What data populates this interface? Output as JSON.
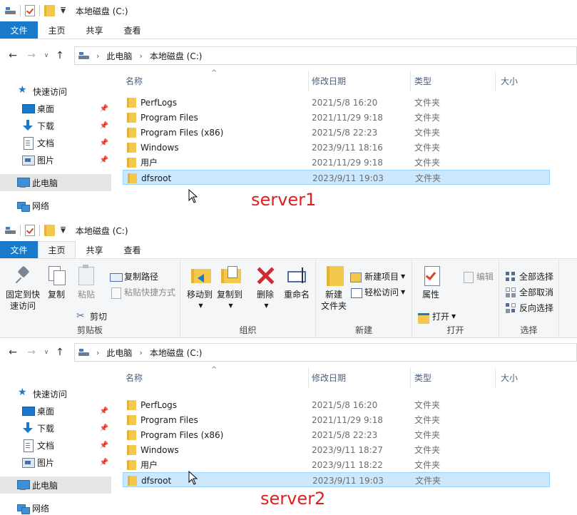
{
  "window1": {
    "title": "本地磁盘 (C:)",
    "tabs": [
      "文件",
      "主页",
      "共享",
      "查看"
    ],
    "breadcrumb": [
      "此电脑",
      "本地磁盘 (C:)"
    ],
    "sidebar": {
      "quick_access": "快速访问",
      "items": [
        "桌面",
        "下载",
        "文档",
        "图片"
      ],
      "this_pc": "此电脑",
      "network": "网络"
    },
    "columns": [
      "名称",
      "修改日期",
      "类型",
      "大小"
    ],
    "files": [
      {
        "name": "PerfLogs",
        "date": "2021/5/8 16:20",
        "type": "文件夹"
      },
      {
        "name": "Program Files",
        "date": "2021/11/29 9:18",
        "type": "文件夹"
      },
      {
        "name": "Program Files (x86)",
        "date": "2021/5/8 22:23",
        "type": "文件夹"
      },
      {
        "name": "Windows",
        "date": "2023/9/11 18:16",
        "type": "文件夹"
      },
      {
        "name": "用户",
        "date": "2021/11/29 9:18",
        "type": "文件夹"
      },
      {
        "name": "dfsroot",
        "date": "2023/9/11 19:03",
        "type": "文件夹"
      }
    ],
    "annotation": "server1"
  },
  "window2": {
    "title": "本地磁盘 (C:)",
    "tabs": [
      "文件",
      "主页",
      "共享",
      "查看"
    ],
    "ribbon": {
      "clipboard": {
        "pin": "固定到快速访问",
        "copy": "复制",
        "paste": "粘贴",
        "copy_path": "复制路径",
        "paste_shortcut": "粘贴快捷方式",
        "cut": "剪切",
        "label": "剪贴板"
      },
      "organize": {
        "move_to": "移动到",
        "copy_to": "复制到",
        "delete": "删除",
        "rename": "重命名",
        "label": "组织"
      },
      "new": {
        "new_folder": "新建\n文件夹",
        "new_item": "新建项目",
        "easy_access": "轻松访问",
        "label": "新建"
      },
      "open": {
        "properties": "属性",
        "open": "打开",
        "edit": "编辑",
        "label": "打开"
      },
      "select": {
        "select_all": "全部选择",
        "select_none": "全部取消",
        "invert": "反向选择",
        "label": "选择"
      }
    },
    "breadcrumb": [
      "此电脑",
      "本地磁盘 (C:)"
    ],
    "sidebar": {
      "quick_access": "快速访问",
      "items": [
        "桌面",
        "下载",
        "文档",
        "图片"
      ],
      "this_pc": "此电脑",
      "network": "网络"
    },
    "columns": [
      "名称",
      "修改日期",
      "类型",
      "大小"
    ],
    "files": [
      {
        "name": "PerfLogs",
        "date": "2021/5/8 16:20",
        "type": "文件夹"
      },
      {
        "name": "Program Files",
        "date": "2021/11/29 9:18",
        "type": "文件夹"
      },
      {
        "name": "Program Files (x86)",
        "date": "2021/5/8 22:23",
        "type": "文件夹"
      },
      {
        "name": "Windows",
        "date": "2023/9/11 18:27",
        "type": "文件夹"
      },
      {
        "name": "用户",
        "date": "2023/9/11 18:22",
        "type": "文件夹"
      },
      {
        "name": "dfsroot",
        "date": "2023/9/11 19:03",
        "type": "文件夹"
      }
    ],
    "annotation": "server2"
  },
  "colors": {
    "file_tab": "#1979ca",
    "selection": "#cce8ff",
    "annotation": "#e02020"
  },
  "icons": [
    "drive-icon",
    "properties-icon",
    "folder-icon",
    "pin-icon",
    "copy-icon",
    "paste-icon",
    "cut-icon",
    "move-to-icon",
    "copy-to-icon",
    "delete-icon",
    "rename-icon",
    "new-folder-icon",
    "select-all-icon",
    "star-icon",
    "desktop-icon",
    "download-icon",
    "document-icon",
    "picture-icon",
    "pc-icon",
    "network-icon"
  ]
}
